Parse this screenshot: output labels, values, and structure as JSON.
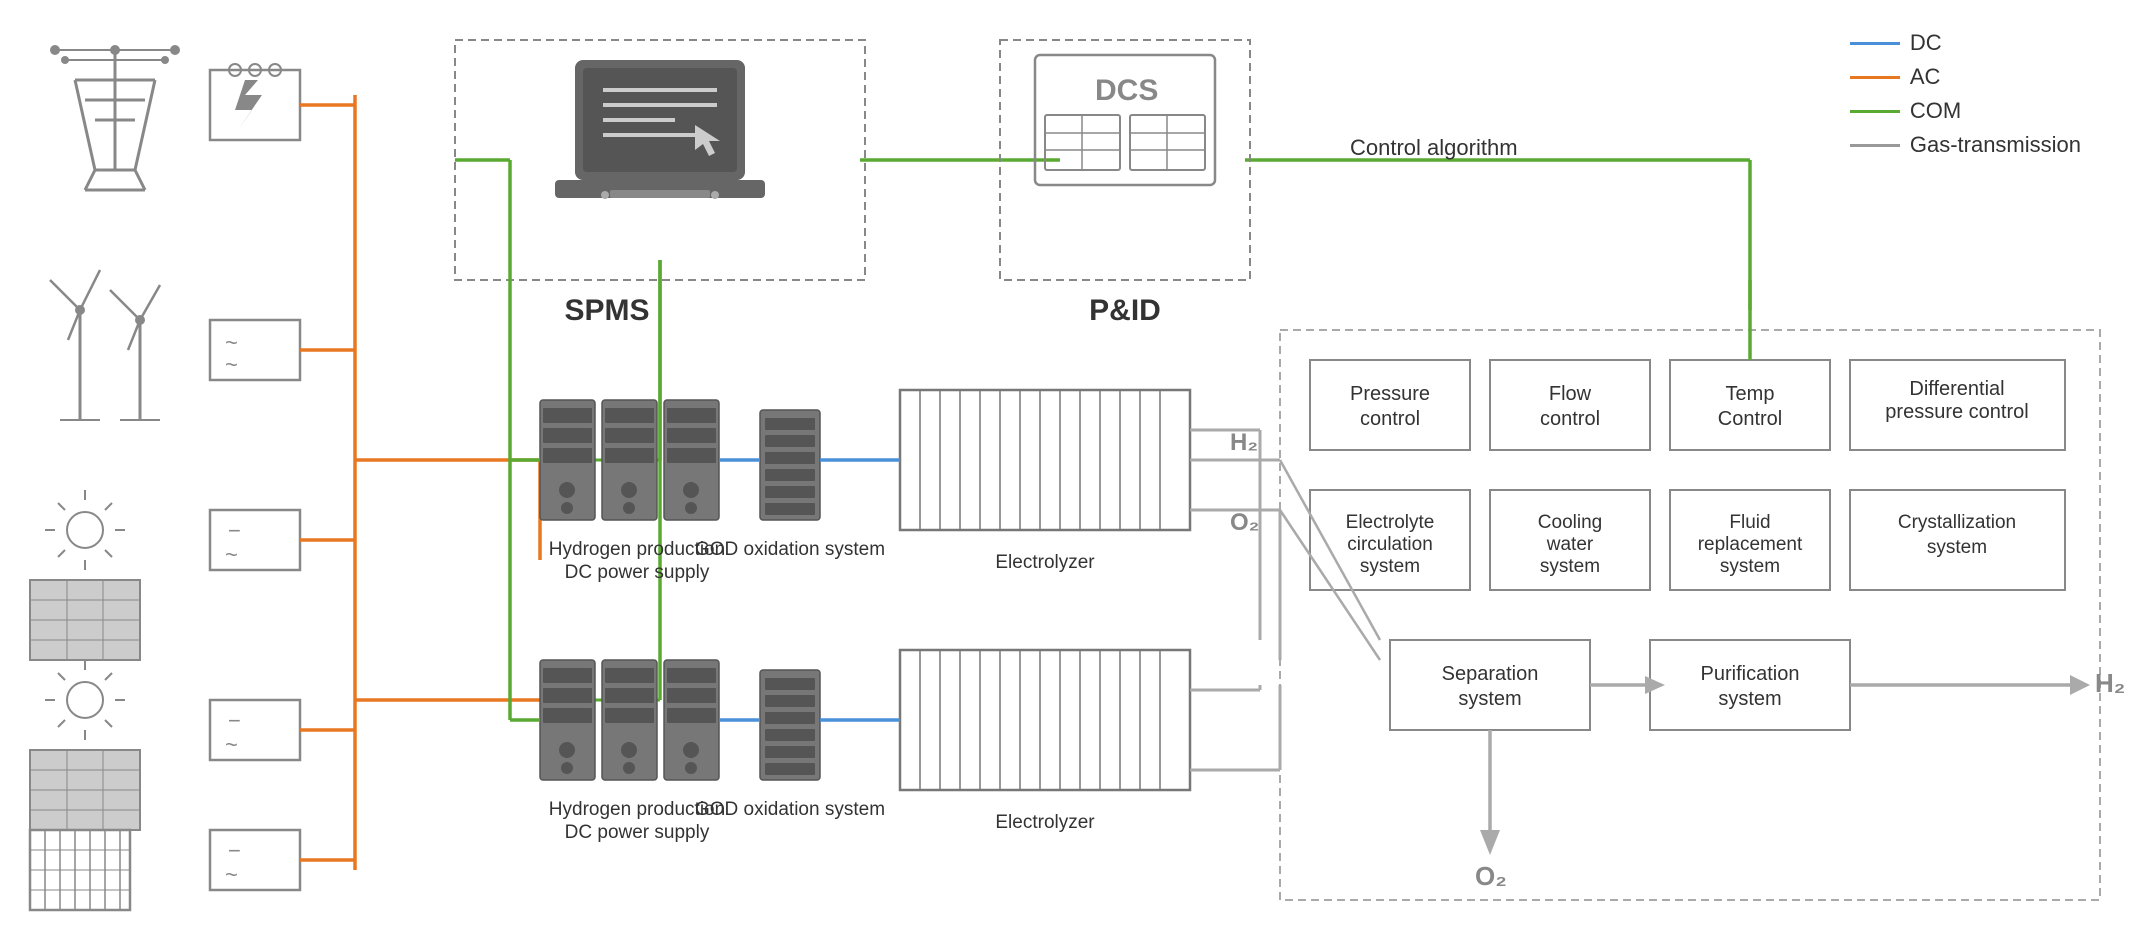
{
  "legend": {
    "items": [
      {
        "label": "DC",
        "color": "#4a90d9"
      },
      {
        "label": "AC",
        "color": "#e87722"
      },
      {
        "label": "COM",
        "color": "#5aaa32"
      },
      {
        "label": "Gas-transmission",
        "color": "#999999"
      }
    ]
  },
  "labels": {
    "spms": "SPMS",
    "pid": "P&ID",
    "control_algorithm": "Control algorithm",
    "pressure_control": "Pressure control",
    "flow_control": "Flow control",
    "temp_control": "Temp Control",
    "differential_pressure": "Differential pressure control",
    "electrolyte_circulation": "Electrolyte circulation system",
    "cooling_water": "Cooling water system",
    "fluid_replacement": "Fluid replacement system",
    "crystallization": "Crystallization system",
    "separation": "Separation system",
    "purification": "Purification system",
    "h2_label1": "H₂",
    "o2_label1": "O₂",
    "h2_label2": "H₂",
    "o2_label2": "O₂",
    "hp_dc1": "Hydrogen production DC power supply",
    "hp_dc2": "Hydrogen production DC power supply",
    "god1": "GOD oxidation system",
    "god2": "GOD oxidation system",
    "electrolyzer1": "Electrolyzer",
    "electrolyzer2": "Electrolyzer"
  }
}
